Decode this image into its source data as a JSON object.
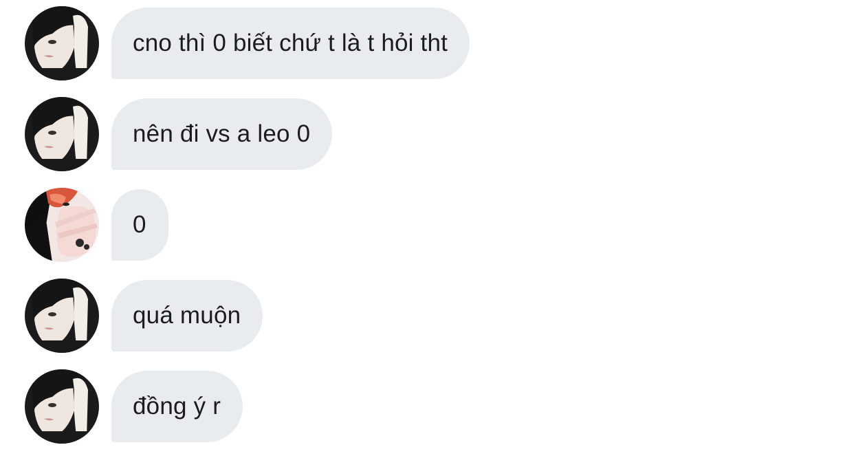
{
  "messages": [
    {
      "sender": "avatar-dark-hair",
      "text": "cno thì 0 biết chứ t là t hỏi tht"
    },
    {
      "sender": "avatar-dark-hair",
      "text": "nên đi vs a leo 0"
    },
    {
      "sender": "avatar-red-hair",
      "text": "0"
    },
    {
      "sender": "avatar-dark-hair",
      "text": "quá muộn"
    },
    {
      "sender": "avatar-dark-hair",
      "text": "đồng ý r"
    }
  ],
  "colors": {
    "bubble_background": "#e9ecef",
    "text": "#1c1c1e",
    "page_background": "#ffffff"
  }
}
